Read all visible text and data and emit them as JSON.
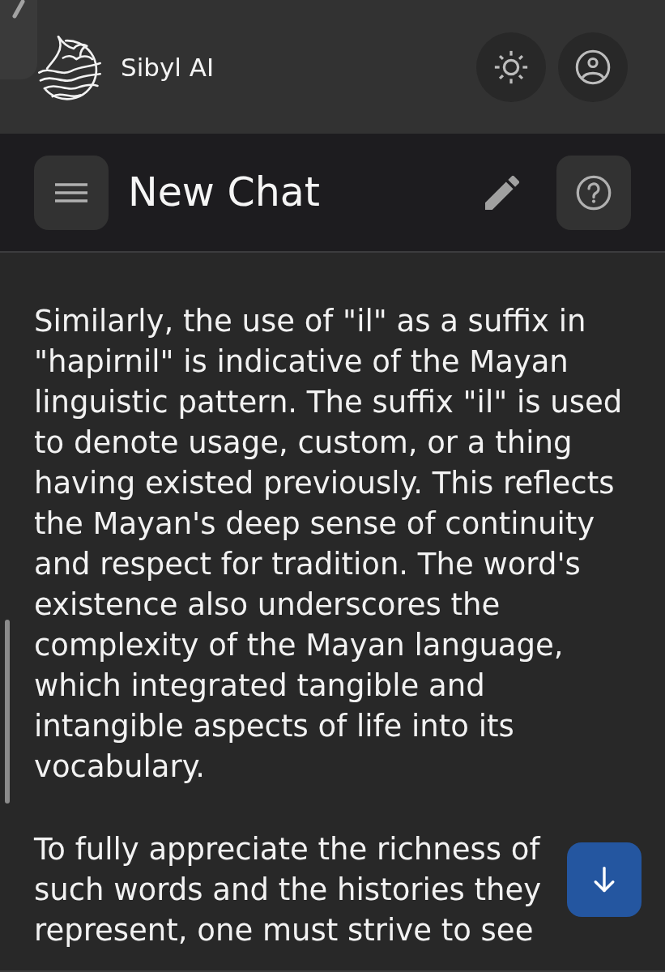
{
  "app": {
    "name": "Sibyl AI"
  },
  "chat": {
    "title": "New Chat"
  },
  "message": {
    "paragraphs": [
      "Similarly, the use of \"il\" as a suffix in \"hapirnil\" is indicative of the Mayan linguistic pattern. The suffix \"il\" is used to denote usage, custom, or a thing having existed previously. This reflects the Mayan's deep sense of continuity and respect for tradition. The word's existence also underscores the complexity of the Mayan language, which integrated tangible and intangible aspects of life into its vocabulary.",
      "To fully appreciate the richness of such words and the histories they represent, one must strive to see"
    ]
  }
}
